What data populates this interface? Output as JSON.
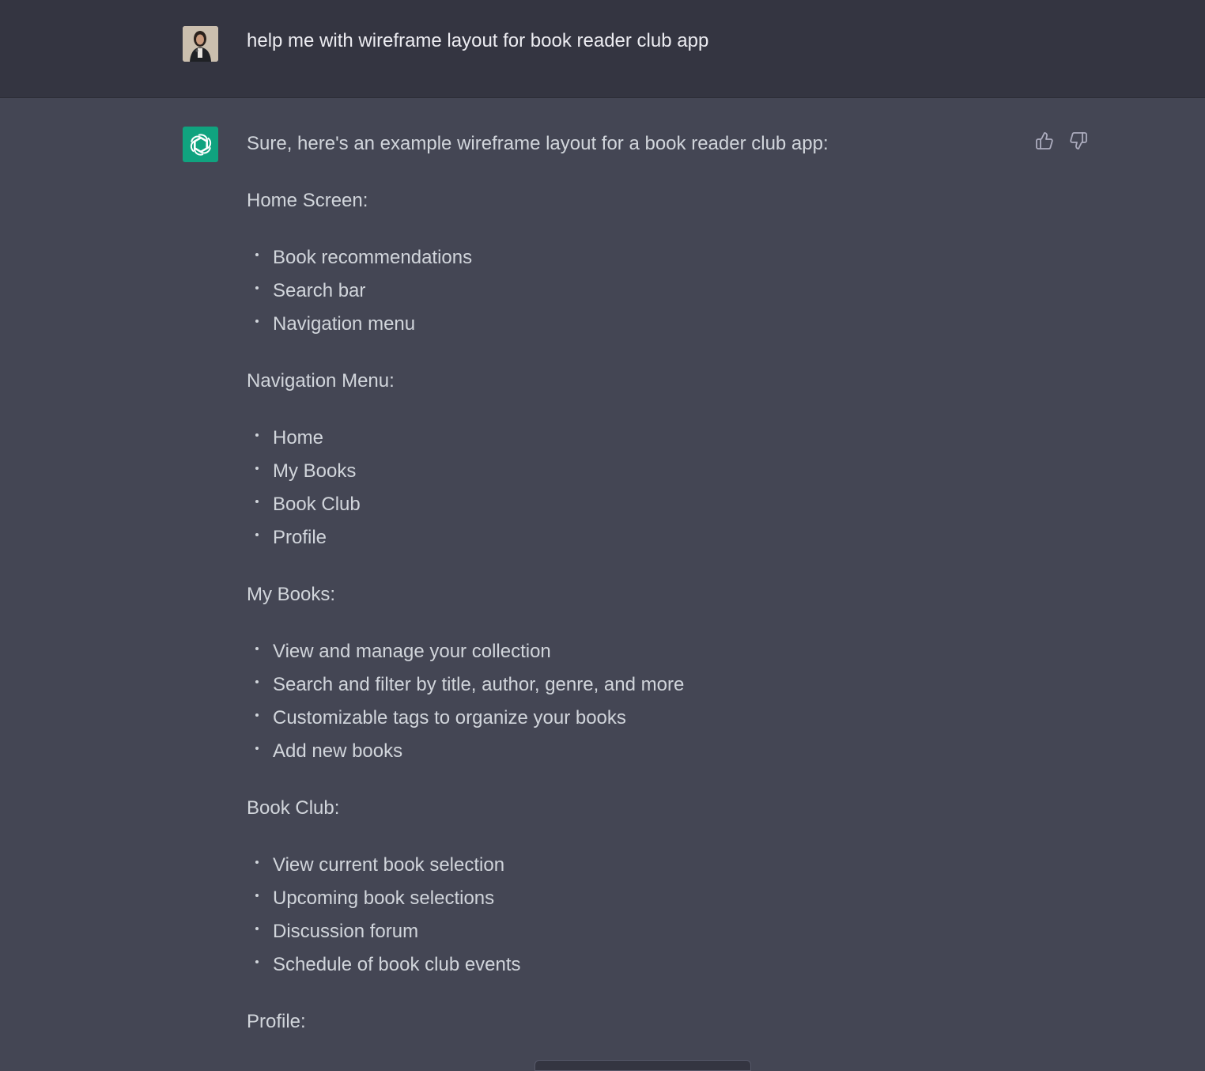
{
  "user_message": {
    "text": "help me with wireframe layout for book reader club app"
  },
  "assistant_message": {
    "intro": "Sure, here's an example wireframe layout for a book reader club app:",
    "sections": [
      {
        "heading": "Home Screen:",
        "items": [
          "Book recommendations",
          "Search bar",
          "Navigation menu"
        ]
      },
      {
        "heading": "Navigation Menu:",
        "items": [
          "Home",
          "My Books",
          "Book Club",
          "Profile"
        ]
      },
      {
        "heading": "My Books:",
        "items": [
          "View and manage your collection",
          "Search and filter by title, author, genre, and more",
          "Customizable tags to organize your books",
          "Add new books"
        ]
      },
      {
        "heading": "Book Club:",
        "items": [
          "View current book selection",
          "Upcoming book selections",
          "Discussion forum",
          "Schedule of book club events"
        ]
      },
      {
        "heading": "Profile:",
        "items": []
      }
    ]
  },
  "icons": {
    "bot": "openai-logo-icon",
    "like": "thumbs-up-icon",
    "dislike": "thumbs-down-icon"
  },
  "colors": {
    "user_bg": "#343541",
    "assistant_bg": "#444654",
    "bot_avatar": "#10a37f",
    "text": "#d1d5db"
  }
}
